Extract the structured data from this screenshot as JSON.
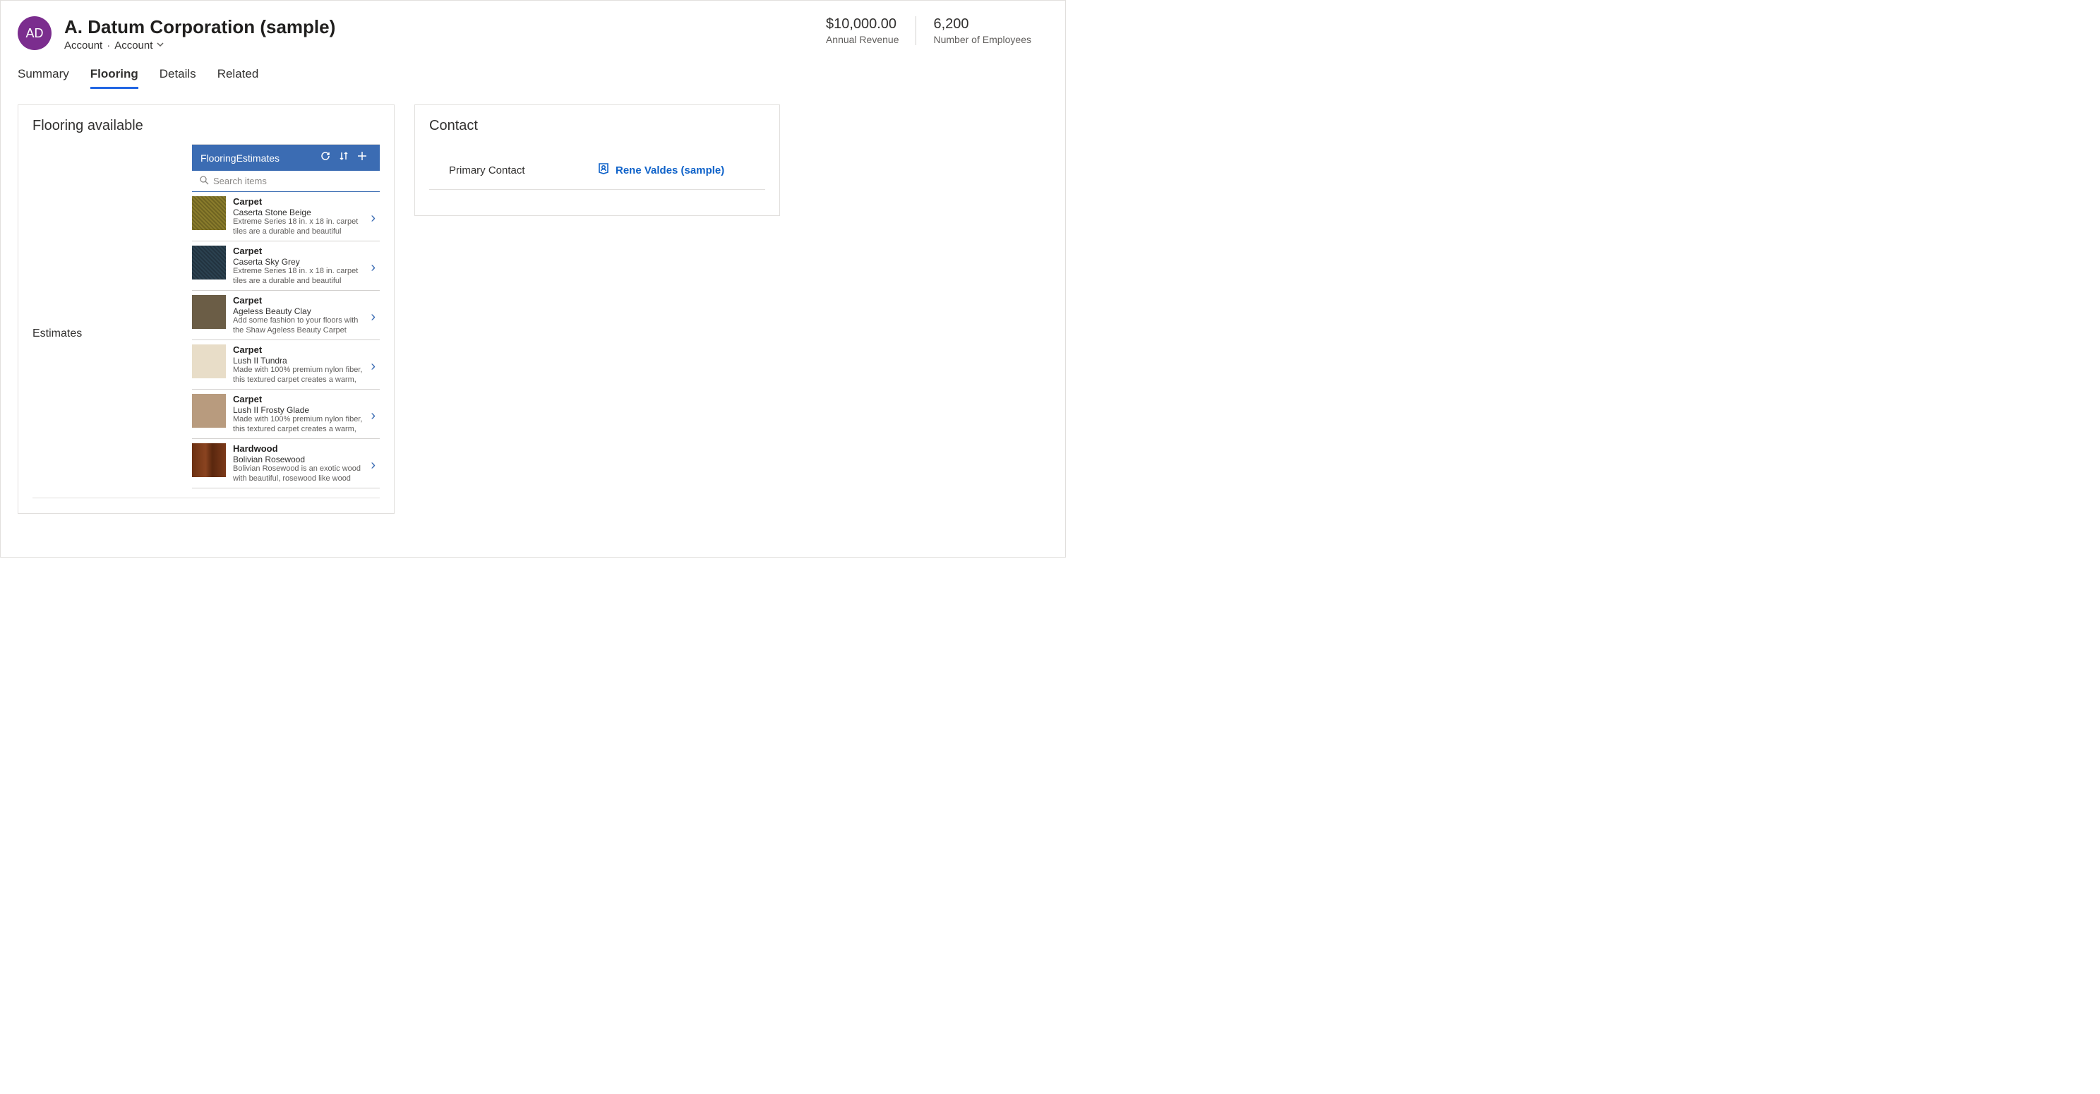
{
  "header": {
    "avatar_initials": "AD",
    "title": "A. Datum Corporation (sample)",
    "entity": "Account",
    "form_name": "Account",
    "stats": [
      {
        "value": "$10,000.00",
        "label": "Annual Revenue"
      },
      {
        "value": "6,200",
        "label": "Number of Employees"
      }
    ]
  },
  "tabs": [
    "Summary",
    "Flooring",
    "Details",
    "Related"
  ],
  "active_tab": "Flooring",
  "flooring_card": {
    "title": "Flooring available",
    "side_label": "Estimates",
    "list_title": "FlooringEstimates",
    "search_placeholder": "Search items",
    "items": [
      {
        "category": "Carpet",
        "name": "Caserta Stone Beige",
        "desc": "Extreme Series 18 in. x 18 in. carpet tiles are a durable and beautiful carpet solution specially engineered for both"
      },
      {
        "category": "Carpet",
        "name": "Caserta Sky Grey",
        "desc": "Extreme Series 18 in. x 18 in. carpet tiles are a durable and beautiful carpet solution specially engineered for both"
      },
      {
        "category": "Carpet",
        "name": "Ageless Beauty Clay",
        "desc": "Add some fashion to your floors with the Shaw Ageless Beauty Carpet collection."
      },
      {
        "category": "Carpet",
        "name": "Lush II Tundra",
        "desc": "Made with 100% premium nylon fiber, this textured carpet creates a warm, casual atmosphere that invites you to"
      },
      {
        "category": "Carpet",
        "name": "Lush II Frosty Glade",
        "desc": "Made with 100% premium nylon fiber, this textured carpet creates a warm, casual atmosphere that invites you to"
      },
      {
        "category": "Hardwood",
        "name": "Bolivian Rosewood",
        "desc": "Bolivian Rosewood is an exotic wood with beautiful, rosewood like wood with"
      }
    ]
  },
  "contact_card": {
    "title": "Contact",
    "field_label": "Primary Contact",
    "contact_name": "Rene Valdes (sample)"
  }
}
